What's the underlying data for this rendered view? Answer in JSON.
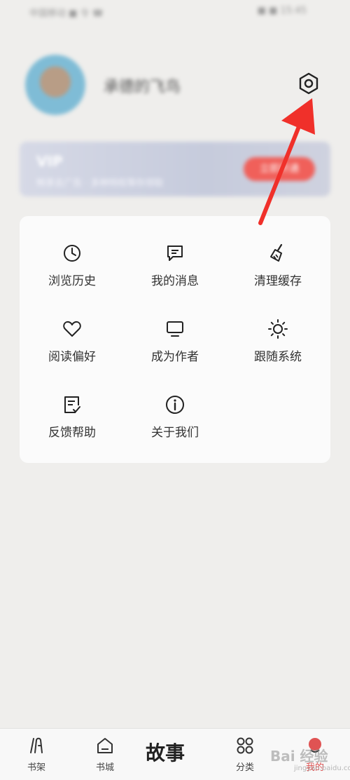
{
  "status_bar": {
    "left": "中国移动 ■ 令 ☎",
    "right": "■ ■ 15:45"
  },
  "profile": {
    "username": "承德的飞鸟"
  },
  "vip": {
    "title": "VIP",
    "subtitle": "畅享去广告 · 多种特权等你领取",
    "button": "立即开通"
  },
  "menu": [
    {
      "label": "浏览历史",
      "icon": "clock-icon"
    },
    {
      "label": "我的消息",
      "icon": "message-icon"
    },
    {
      "label": "清理缓存",
      "icon": "broom-icon"
    },
    {
      "label": "阅读偏好",
      "icon": "heart-icon"
    },
    {
      "label": "成为作者",
      "icon": "monitor-icon"
    },
    {
      "label": "跟随系统",
      "icon": "sun-icon"
    },
    {
      "label": "反馈帮助",
      "icon": "feedback-icon"
    },
    {
      "label": "关于我们",
      "icon": "info-icon"
    }
  ],
  "nav": {
    "tabs": [
      {
        "label": "书架",
        "icon": "bookshelf-icon"
      },
      {
        "label": "书城",
        "icon": "store-icon"
      },
      {
        "label": "分类",
        "icon": "category-icon"
      },
      {
        "label": "我的",
        "icon": "profile-icon",
        "active": true
      }
    ],
    "logo": "故事"
  },
  "watermark": {
    "text": "Bai 经验",
    "url": "jingyan.baidu.com"
  },
  "colors": {
    "accent": "#e05353",
    "arrow": "#f0302a",
    "vip_button": "#f0605a"
  }
}
